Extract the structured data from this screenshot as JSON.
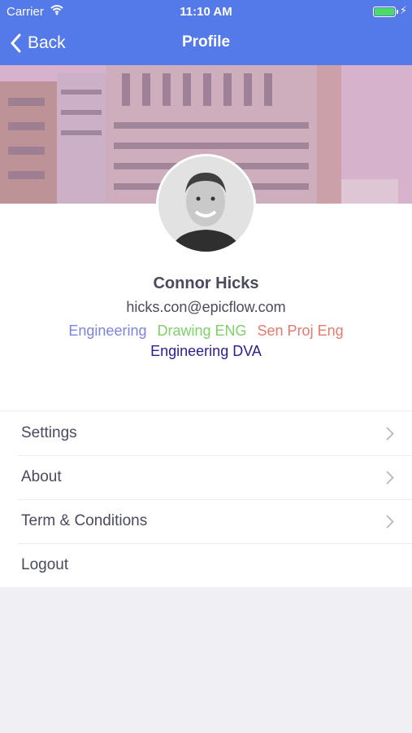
{
  "status_bar": {
    "carrier": "Carrier",
    "time": "11:10 AM",
    "battery_level": 1.0
  },
  "nav": {
    "back_label": "Back",
    "title": "Profile"
  },
  "profile": {
    "name": "Connor Hicks",
    "email": "hicks.con@epicflow.com",
    "tags": [
      {
        "label": "Engineering",
        "color": "#7b84e0"
      },
      {
        "label": "Drawing ENG",
        "color": "#7fcf6a"
      },
      {
        "label": "Sen Proj Eng",
        "color": "#e8796e"
      },
      {
        "label": "Engineering DVA",
        "color": "#2a1f8f"
      }
    ]
  },
  "menu": {
    "items": [
      {
        "label": "Settings",
        "chevron": true
      },
      {
        "label": "About",
        "chevron": true
      },
      {
        "label": "Term & Conditions",
        "chevron": true
      },
      {
        "label": "Logout",
        "chevron": false
      }
    ]
  },
  "colors": {
    "accent": "#5479e8",
    "background": "#efeff4"
  }
}
